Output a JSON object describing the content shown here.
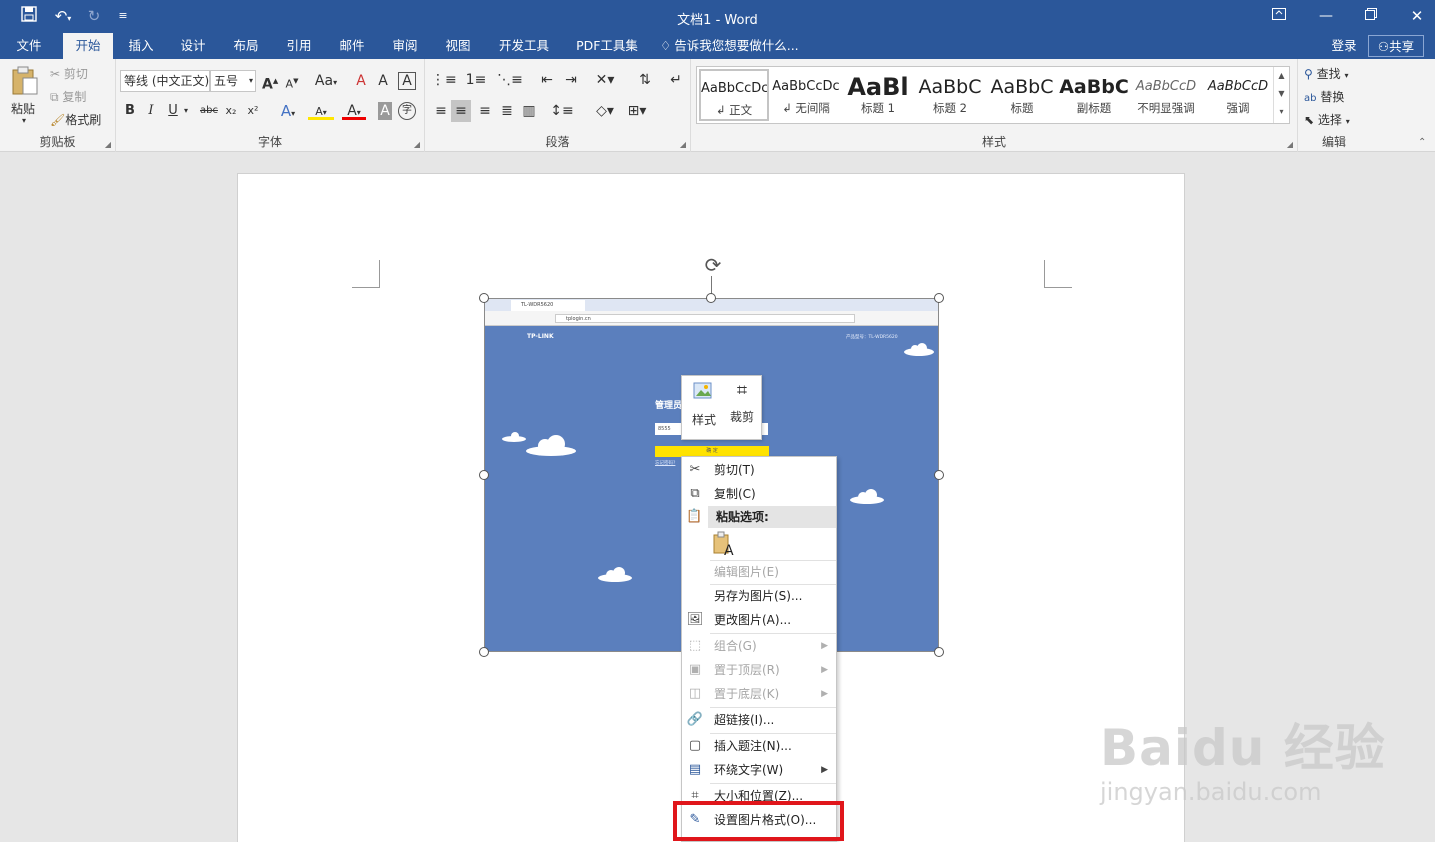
{
  "window": {
    "title": "文档1 - Word"
  },
  "quick_access": {
    "save": "save-icon",
    "undo": "undo-icon",
    "redo": "redo-icon",
    "customize": "customize-icon"
  },
  "tabs": {
    "file": "文件",
    "home": "开始",
    "insert": "插入",
    "design": "设计",
    "layout": "布局",
    "references": "引用",
    "mailings": "邮件",
    "review": "审阅",
    "view": "视图",
    "developer": "开发工具",
    "pdf": "PDF工具集",
    "tellme": "告诉我您想要做什么...",
    "login": "登录",
    "share": "共享"
  },
  "ribbon": {
    "clipboard": {
      "label": "剪贴板",
      "paste": "粘贴",
      "cut": "剪切",
      "copy": "复制",
      "format_painter": "格式刷"
    },
    "font": {
      "label": "字体",
      "font_name": "等线 (中文正文)",
      "font_size": "五号",
      "bold": "B",
      "italic": "I",
      "underline": "U",
      "strike": "abc",
      "sub": "x₂",
      "sup": "x²",
      "grow": "A",
      "shrink": "A",
      "case": "Aa",
      "clear": "A",
      "phonetic": "A",
      "enclose": "A",
      "font_color": "A",
      "highlight": "A",
      "char_shade": "A",
      "circle": "字"
    },
    "paragraph": {
      "label": "段落"
    },
    "styles": {
      "label": "样式",
      "items": [
        {
          "preview": "AaBbCcDc",
          "name": "正文"
        },
        {
          "preview": "AaBbCcDc",
          "name": "无间隔"
        },
        {
          "preview": "AaBl",
          "name": "标题 1"
        },
        {
          "preview": "AaBbC",
          "name": "标题 2"
        },
        {
          "preview": "AaBbC",
          "name": "标题"
        },
        {
          "preview": "AaBbC",
          "name": "副标题"
        },
        {
          "preview": "AaBbCcD",
          "name": "不明显强调"
        },
        {
          "preview": "AaBbCcD",
          "name": "强调"
        }
      ]
    },
    "editing": {
      "label": "编辑",
      "find": "查找",
      "replace": "替换",
      "select": "选择"
    }
  },
  "picture": {
    "brand": "TP-LINK",
    "url": "tplogin.cn",
    "tab": "TL-WDR5620",
    "model": "产品型号：TL-WDR5620",
    "heading": "管理员",
    "button": "确 定",
    "link": "忘记密码?",
    "field": "8555"
  },
  "mini_toolbar": {
    "style": "样式",
    "crop": "裁剪"
  },
  "context_menu": {
    "cut": "剪切(T)",
    "copy": "复制(C)",
    "paste_header": "粘贴选项:",
    "edit_picture": "编辑图片(E)",
    "save_as_picture": "另存为图片(S)...",
    "change_picture": "更改图片(A)...",
    "group": "组合(G)",
    "bring_front": "置于顶层(R)",
    "send_back": "置于底层(K)",
    "hyperlink": "超链接(I)...",
    "insert_caption": "插入题注(N)...",
    "wrap_text": "环绕文字(W)",
    "size_position": "大小和位置(Z)...",
    "format_picture": "设置图片格式(O)..."
  },
  "watermark": {
    "logo": "Baidu 经验",
    "url": "jingyan.baidu.com"
  },
  "colors": {
    "accent": "#2b579a",
    "highlight_box": "#e0161b",
    "picture_bg": "#5b7fbd"
  }
}
